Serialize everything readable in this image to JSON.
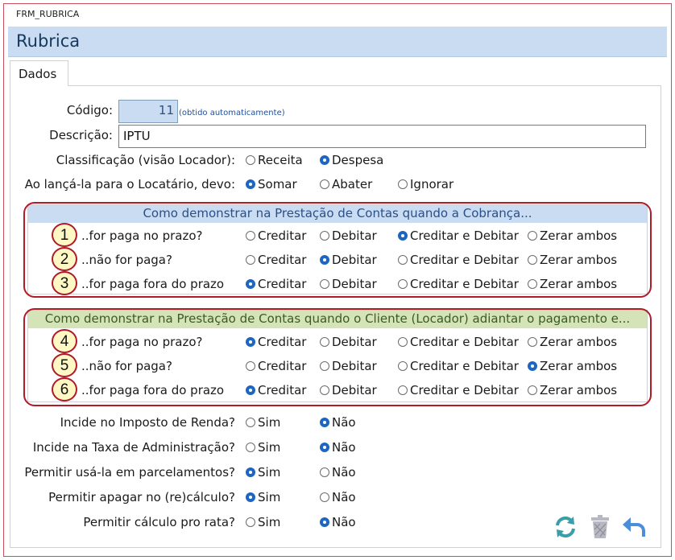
{
  "window": {
    "title": "FRM_RUBRICA"
  },
  "header": {
    "title": "Rubrica"
  },
  "tabs": [
    {
      "label": "Dados"
    }
  ],
  "form": {
    "codigo": {
      "label": "Código:",
      "value": "11",
      "note": "(obtido automaticamente)"
    },
    "descricao": {
      "label": "Descrição:",
      "value": "IPTU"
    },
    "classificacao": {
      "label": "Classificação (visão Locador):",
      "options": [
        {
          "label": "Receita",
          "selected": false
        },
        {
          "label": "Despesa",
          "selected": true
        }
      ]
    },
    "lancamento": {
      "label": "Ao lançá-la para o Locatário, devo:",
      "options": [
        {
          "label": "Somar",
          "selected": true
        },
        {
          "label": "Abater",
          "selected": false
        },
        {
          "label": "Ignorar",
          "selected": false
        }
      ]
    }
  },
  "options_labels": [
    "Creditar",
    "Debitar",
    "Creditar e Debitar",
    "Zerar ambos"
  ],
  "group1": {
    "title": "Como demonstrar na Prestação de Contas quando a Cobrança...",
    "rows": [
      {
        "num": "1",
        "label": "..for paga no prazo?",
        "selected": 2
      },
      {
        "num": "2",
        "label": "..não for paga?",
        "selected": 1
      },
      {
        "num": "3",
        "label": "..for paga fora do prazo",
        "selected": 0
      }
    ]
  },
  "group2": {
    "title": "Como demonstrar na Prestação de Contas quando o Cliente (Locador) adiantar o pagamento e...",
    "rows": [
      {
        "num": "4",
        "label": "..for paga no prazo?",
        "selected": 0
      },
      {
        "num": "5",
        "label": "..não for paga?",
        "selected": 3
      },
      {
        "num": "6",
        "label": "..for paga fora do prazo",
        "selected": 0
      }
    ]
  },
  "yes_no": {
    "yes": "Sim",
    "no": "Não"
  },
  "questions": [
    {
      "label": "Incide no Imposto de Renda?",
      "selected": "no"
    },
    {
      "label": "Incide na Taxa de Administração?",
      "selected": "no"
    },
    {
      "label": "Permitir usá-la em parcelamentos?",
      "selected": "yes"
    },
    {
      "label": "Permitir apagar no (re)cálculo?",
      "selected": "yes"
    },
    {
      "label": "Permitir cálculo pro rata?",
      "selected": "no"
    }
  ],
  "actions": [
    {
      "icon": "refresh-icon"
    },
    {
      "icon": "trash-icon"
    },
    {
      "icon": "undo-icon"
    }
  ],
  "colors": {
    "accent": "#1d66c2",
    "header_bg": "#c9dcf2",
    "group_border": "#b01b2a",
    "green_header": "#d4e3b8"
  }
}
